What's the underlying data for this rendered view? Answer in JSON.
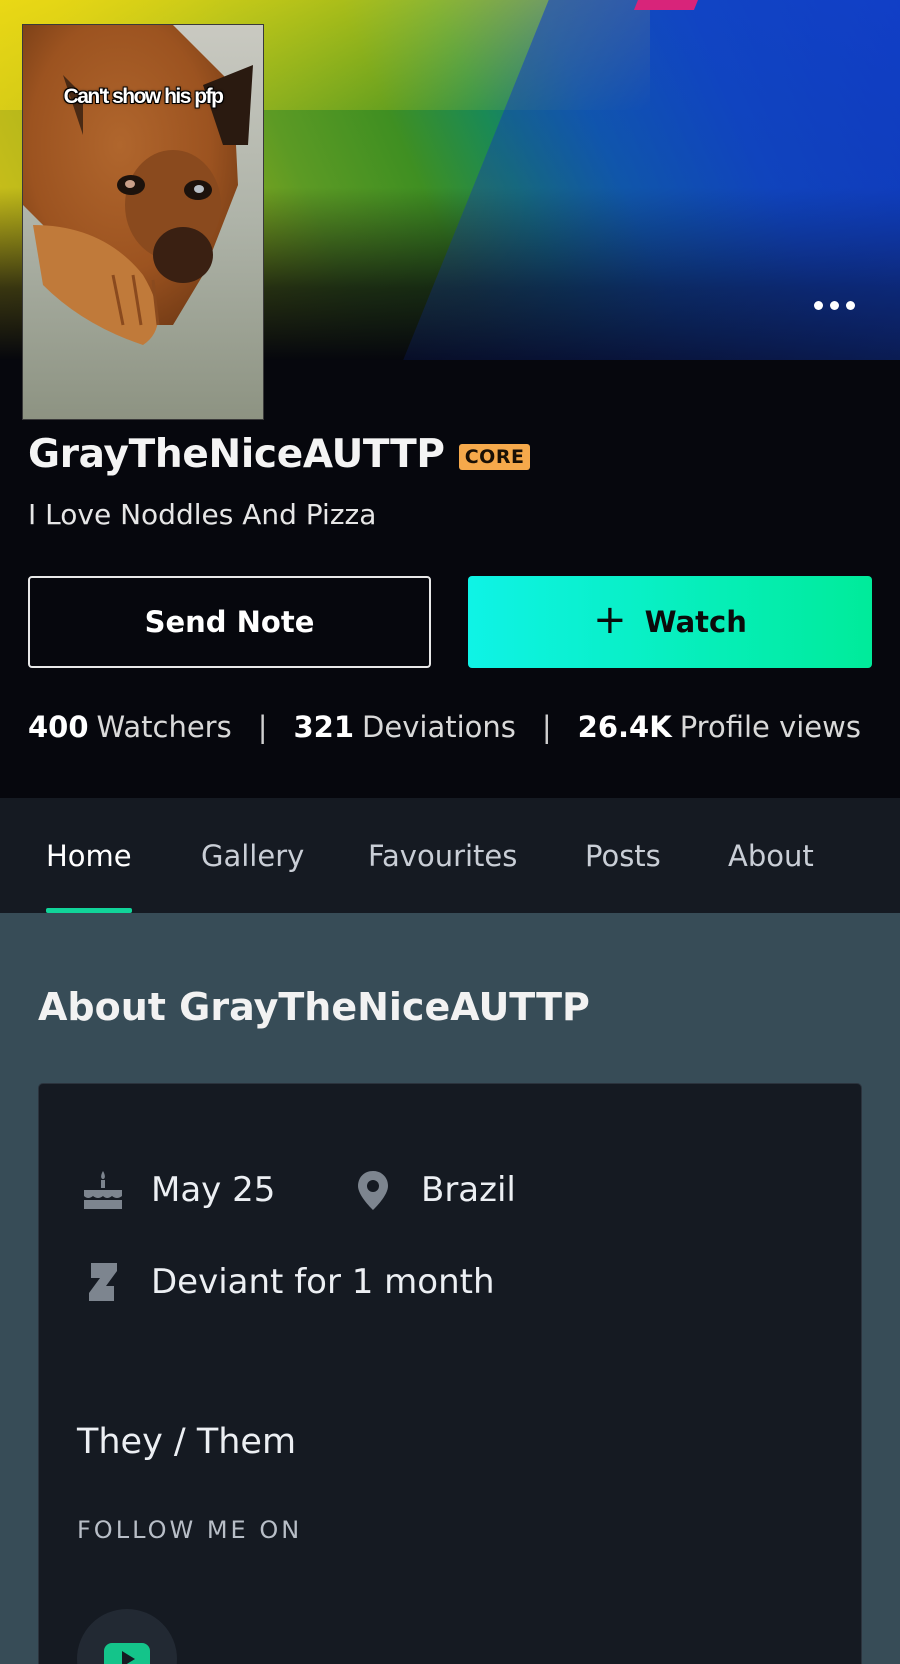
{
  "profile": {
    "avatar_caption": "Can't show his pfp",
    "username": "GrayTheNiceAUTTP",
    "badge": "CORE",
    "tagline": "I Love Noddles And Pizza"
  },
  "actions": {
    "send_note_label": "Send Note",
    "watch_plus": "+",
    "watch_label": "Watch",
    "more_icon": "more-horizontal-icon"
  },
  "stats": {
    "watchers_count": "400",
    "watchers_label": "Watchers",
    "deviations_count": "321",
    "deviations_label": "Deviations",
    "views_count": "26.4K",
    "views_label": "Profile views",
    "separator": "|"
  },
  "tabs": [
    {
      "label": "Home",
      "active": true
    },
    {
      "label": "Gallery",
      "active": false
    },
    {
      "label": "Favourites",
      "active": false
    },
    {
      "label": "Posts",
      "active": false
    },
    {
      "label": "About",
      "active": false
    }
  ],
  "about": {
    "title": "About GrayTheNiceAUTTP",
    "birthday": "May 25",
    "location": "Brazil",
    "deviant_for": "Deviant for 1 month",
    "pronouns": "They / Them",
    "follow_label": "FOLLOW ME ON",
    "social": [
      {
        "icon": "youtube-icon"
      }
    ]
  },
  "colors": {
    "accent": "#11d49a",
    "watch_gradient_start": "#0ff3e6",
    "watch_gradient_end": "#00eb9a",
    "core_badge": "#f6a94b",
    "youtube_icon": "#14c48a"
  }
}
